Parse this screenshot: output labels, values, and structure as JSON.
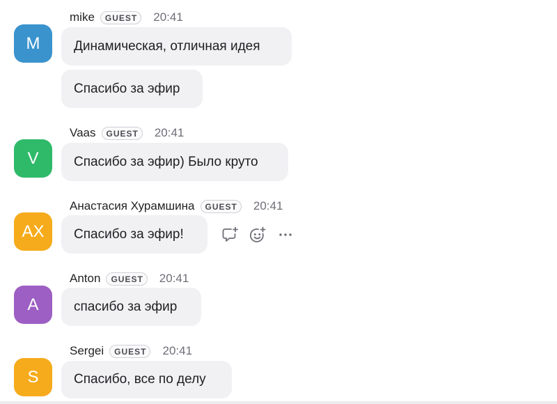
{
  "badge_label": "GUEST",
  "colors": {
    "bubble": "#f1f1f4",
    "avatar_m": "#3a93cd",
    "avatar_v": "#2fba6a",
    "avatar_ax": "#f6ab1c",
    "avatar_a": "#9d5fc4",
    "avatar_s": "#f6ab1c"
  },
  "messages": [
    {
      "sender": "mike",
      "initials": "M",
      "time": "20:41",
      "texts": [
        "Динамическая, отличная идея",
        "Спасибо за эфир"
      ]
    },
    {
      "sender": "Vaas",
      "initials": "V",
      "time": "20:41",
      "texts": [
        "Спасибо за эфир) Было круто"
      ]
    },
    {
      "sender": "Анастасия Хурамшина",
      "initials": "AX",
      "time": "20:41",
      "texts": [
        "Спасибо за эфир!"
      ],
      "hover_actions": [
        "reply-in-thread-icon",
        "add-reaction-icon",
        "more-options-icon"
      ]
    },
    {
      "sender": "Anton",
      "initials": "A",
      "time": "20:41",
      "texts": [
        "спасибо за эфир"
      ]
    },
    {
      "sender": "Sergei",
      "initials": "S",
      "time": "20:41",
      "texts": [
        "Спасибо, все по делу"
      ]
    }
  ]
}
